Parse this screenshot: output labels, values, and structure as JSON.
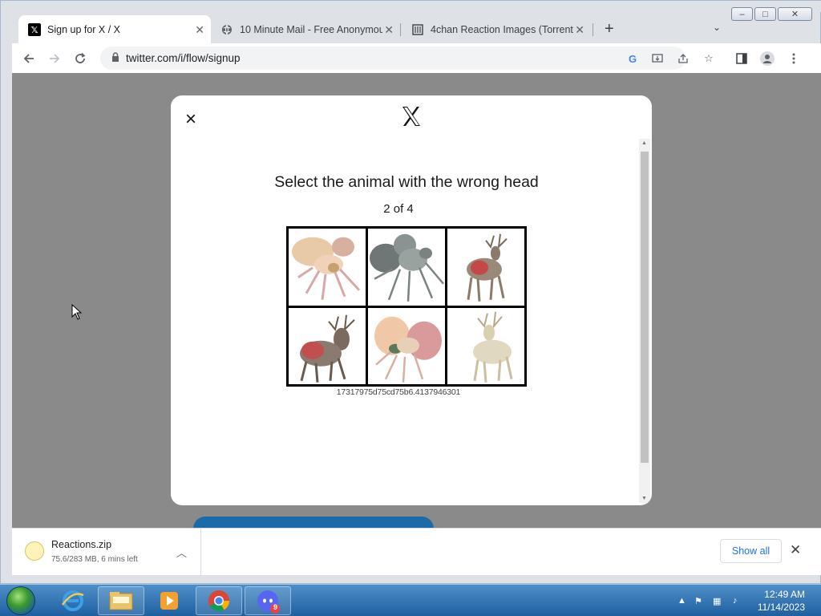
{
  "browser": {
    "tabs": [
      {
        "title": "Sign up for X / X",
        "favicon": "x-logo-icon",
        "active": true
      },
      {
        "title": "10 Minute Mail - Free Anonymou",
        "favicon": "globe-icon",
        "active": false
      },
      {
        "title": "4chan Reaction Images (Torrent)",
        "favicon": "archive-icon",
        "active": false
      }
    ],
    "url": "twitter.com/i/flow/signup",
    "window_controls": {
      "minimize": "–",
      "maximize": "□",
      "close": "✕"
    }
  },
  "modal": {
    "close_glyph": "×",
    "logo": "x-logo-icon",
    "captcha": {
      "title": "Select the animal with the wrong head",
      "progress": "2 of 4",
      "tiles": [
        {
          "content": "ant with pink body",
          "colors": [
            "#e8c4b0",
            "#d8a8a8"
          ]
        },
        {
          "content": "ant grey",
          "colors": [
            "#8a9090",
            "#aab0b0"
          ]
        },
        {
          "content": "deer with red patch",
          "colors": [
            "#9a7a68",
            "#c04a4a"
          ]
        },
        {
          "content": "deer with ant head",
          "colors": [
            "#9a8a80",
            "#c05050"
          ]
        },
        {
          "content": "ant pink and green",
          "colors": [
            "#e8c4b0",
            "#5a8a5a"
          ]
        },
        {
          "content": "deer beige",
          "colors": [
            "#d8d0b8",
            "#c8c0a8"
          ]
        }
      ],
      "id": "17317975d75cd75b6.4137946301"
    }
  },
  "download_shelf": {
    "file_name": "Reactions.zip",
    "status": "75.6/283 MB, 6 mins left",
    "show_all": "Show all"
  },
  "taskbar": {
    "apps": [
      "internet-explorer-icon",
      "file-explorer-icon",
      "media-player-icon",
      "chrome-icon",
      "discord-icon"
    ],
    "discord_badge": "9",
    "time": "12:49 AM",
    "date": "11/14/2023"
  }
}
